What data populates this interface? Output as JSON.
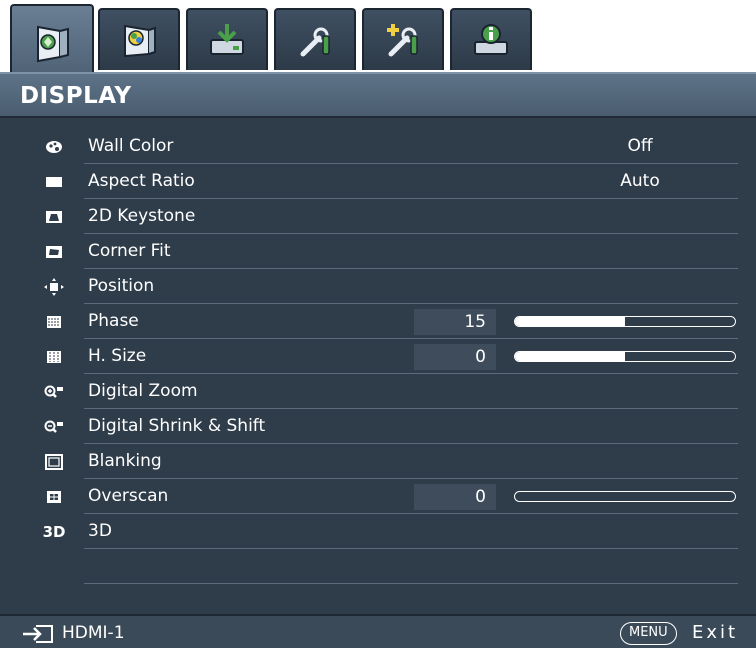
{
  "tabs": [
    {
      "icon": "display-icon",
      "active": true
    },
    {
      "icon": "picture-icon",
      "active": false
    },
    {
      "icon": "source-icon",
      "active": false
    },
    {
      "icon": "system-setup-basic-icon",
      "active": false
    },
    {
      "icon": "system-setup-advanced-icon",
      "active": false
    },
    {
      "icon": "information-icon",
      "active": false
    }
  ],
  "header": {
    "title": "DISPLAY"
  },
  "menu": {
    "items": [
      {
        "label": "Wall Color",
        "icon": "wall-color-icon",
        "value": "Off"
      },
      {
        "label": "Aspect Ratio",
        "icon": "aspect-ratio-icon",
        "value": "Auto"
      },
      {
        "label": "2D Keystone",
        "icon": "keystone-icon",
        "value": ""
      },
      {
        "label": "Corner Fit",
        "icon": "corner-fit-icon",
        "value": ""
      },
      {
        "label": "Position",
        "icon": "position-icon",
        "value": ""
      },
      {
        "label": "Phase",
        "icon": "phase-icon",
        "number": "15",
        "level": 0.5
      },
      {
        "label": "H. Size",
        "icon": "h-size-icon",
        "number": "0",
        "level": 0.5
      },
      {
        "label": "Digital Zoom",
        "icon": "digital-zoom-icon",
        "value": ""
      },
      {
        "label": "Digital Shrink & Shift",
        "icon": "digital-shrink-icon",
        "value": ""
      },
      {
        "label": "Blanking",
        "icon": "blanking-icon",
        "value": ""
      },
      {
        "label": "Overscan",
        "icon": "overscan-icon",
        "number": "0",
        "level": 0.0
      },
      {
        "label": "3D",
        "icon": "3d-icon",
        "icon_text": "3D",
        "value": ""
      }
    ]
  },
  "footer": {
    "source_icon": "input-source-icon",
    "source": "HDMI-1",
    "menu_button": "MENU",
    "exit": "Exit"
  },
  "colors": {
    "panel": "#2f3c4a",
    "header": "#5e7388",
    "text": "#ffffff",
    "value_box": "#3e4c5b"
  }
}
